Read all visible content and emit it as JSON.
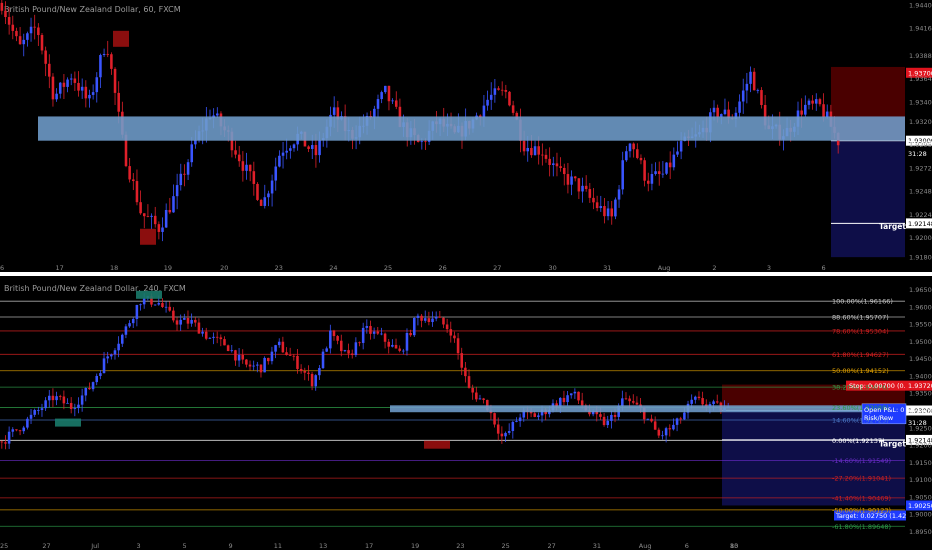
{
  "theme": {
    "bg": "#000000",
    "up": "#3a55ff",
    "down": "#e0202a",
    "zone": "#6f9dcc",
    "fib_grey": "#c8c8c8",
    "fib_red": "#d02020",
    "fib_orange": "#e0a000",
    "fib_green": "#2e9e4a",
    "fib_purple": "#6a2cc7",
    "fib_blue": "#4b79c8",
    "target_box": "#0e0e48",
    "stop_box": "#4a0000",
    "marker_green": "#1a7a6a",
    "marker_red": "#9a1010"
  },
  "chart_data": [
    {
      "type": "candlestick",
      "title": "British Pound/New Zealand Dollar, 60, FXCM",
      "ylim": [
        1.9175,
        1.9445
      ],
      "y_ticks": [
        "1.94400",
        "1.94160",
        "1.93880",
        "1.93640",
        "1.93400",
        "1.93200",
        "1.92960",
        "1.92720",
        "1.92480",
        "1.92240",
        "1.92000",
        "1.91800"
      ],
      "y_tick_values": [
        1.944,
        1.9416,
        1.9388,
        1.9364,
        1.934,
        1.932,
        1.9296,
        1.9272,
        1.9248,
        1.9224,
        1.92,
        1.918
      ],
      "x_ticks": [
        "6",
        "17",
        "18",
        "19",
        "20",
        "23",
        "24",
        "25",
        "26",
        "27",
        "30",
        "31",
        "Aug",
        "2",
        "3",
        "6"
      ],
      "x_tick_fracs": [
        0.0,
        0.066,
        0.131,
        0.195,
        0.262,
        0.327,
        0.392,
        0.457,
        0.522,
        0.587,
        0.653,
        0.718,
        0.783,
        0.848,
        0.913,
        0.978
      ],
      "price_labels": [
        {
          "text": "1.93700",
          "value": 1.937,
          "style": "stop"
        },
        {
          "text": "1.93000",
          "value": 1.93,
          "style": "white"
        },
        {
          "text": "1.92975",
          "value": 1.92975,
          "style": "plain"
        },
        {
          "text": "31:28",
          "value": 1.9287,
          "style": "plain"
        },
        {
          "text": "1.92148",
          "value": 1.92148,
          "style": "white"
        }
      ],
      "annotations": [
        {
          "text": "Target",
          "value": 1.9212
        }
      ],
      "zone": [
        1.93,
        1.9325
      ],
      "series_anchors": [
        1.9442,
        1.9395,
        1.9418,
        1.9345,
        1.9368,
        1.9338,
        1.9405,
        1.929,
        1.9225,
        1.921,
        1.9245,
        1.9295,
        1.933,
        1.9305,
        1.927,
        1.9235,
        1.929,
        1.9305,
        1.9285,
        1.933,
        1.9305,
        1.932,
        1.935,
        1.9315,
        1.9295,
        1.932,
        1.9305,
        1.932,
        1.9345,
        1.935,
        1.9295,
        1.929,
        1.9265,
        1.9255,
        1.9235,
        1.922,
        1.9305,
        1.926,
        1.9265,
        1.9295,
        1.9305,
        1.933,
        1.9325,
        1.937,
        1.931,
        1.9308,
        1.9335,
        1.9335,
        1.93
      ]
    },
    {
      "type": "candlestick",
      "title": "British Pound/New Zealand Dollar, 240, FXCM",
      "ylim": [
        1.8925,
        1.9675
      ],
      "y_ticks": [
        "1.96500",
        "1.96000",
        "1.95500",
        "1.95000",
        "1.94500",
        "1.94000",
        "1.93500",
        "1.92500",
        "1.92000",
        "1.91500",
        "1.91000",
        "1.90500",
        "1.90000",
        "1.89500"
      ],
      "y_tick_values": [
        1.965,
        1.96,
        1.955,
        1.95,
        1.945,
        1.94,
        1.935,
        1.925,
        1.92,
        1.915,
        1.91,
        1.905,
        1.9,
        1.895
      ],
      "x_ticks": [
        "25",
        "27",
        "Jul",
        "3",
        "5",
        "9",
        "11",
        "13",
        "17",
        "19",
        "23",
        "25",
        "27",
        "31",
        "Aug",
        "6",
        "8",
        "10",
        "13"
      ],
      "x_tick_fracs": [
        0.0,
        0.058,
        0.125,
        0.187,
        0.25,
        0.313,
        0.375,
        0.437,
        0.5,
        0.563,
        0.625,
        0.687,
        0.75,
        0.812,
        0.875,
        0.938,
        1.0,
        1.0,
        1.0
      ],
      "fib_levels": [
        {
          "label": "100.00%(1.96166)",
          "value": 1.96166,
          "color": "grey"
        },
        {
          "label": "88.60%(1.95707)",
          "value": 1.95707,
          "color": "grey"
        },
        {
          "label": "78.60%(1.95304)",
          "value": 1.95304,
          "color": "red"
        },
        {
          "label": "61.80%(1.94627)",
          "value": 1.94627,
          "color": "red"
        },
        {
          "label": "50.00%(1.94152)",
          "value": 1.94152,
          "color": "orange"
        },
        {
          "label": "38.20%(1.93676)",
          "value": 1.93676,
          "color": "green"
        },
        {
          "label": "23.60%(1.93088)",
          "value": 1.93088,
          "color": "green"
        },
        {
          "label": "14.60%(1.92725)",
          "value": 1.92725,
          "color": "blue"
        },
        {
          "label": "0.00%(1.92137)",
          "value": 1.92137,
          "color": "white"
        },
        {
          "label": "-14.60%(1.91549)",
          "value": 1.91549,
          "color": "purple"
        },
        {
          "label": "-27.20%(1.91041)",
          "value": 1.91041,
          "color": "red"
        },
        {
          "label": "-41.40%(1.90469)",
          "value": 1.90469,
          "color": "red"
        },
        {
          "label": "-50.00%(1.90123)",
          "value": 1.90123,
          "color": "orange"
        },
        {
          "label": "-61.80%(1.89648)",
          "value": 1.89648,
          "color": "green"
        }
      ],
      "price_labels": [
        {
          "text": "1.93720",
          "value": 1.9372,
          "style": "stop"
        },
        {
          "text": "1.93000",
          "value": 1.93,
          "style": "white"
        },
        {
          "text": "1.92975",
          "value": 1.92975,
          "style": "plain"
        },
        {
          "text": "31:28",
          "value": 1.9265,
          "style": "plain"
        },
        {
          "text": "1.92148",
          "value": 1.92148,
          "style": "white"
        },
        {
          "text": "1.90250",
          "value": 1.9025,
          "style": "blue"
        }
      ],
      "position_labels": {
        "stop": "Stop: 0.00700 (0.",
        "open_pl": "Open P&L: 0",
        "risk": "Risk/Rew",
        "target": "Target: 0.02750 (1.42"
      },
      "annotations": [
        {
          "text": "Target",
          "value": 1.9205
        }
      ],
      "zone": [
        1.9295,
        1.9315
      ],
      "series_anchors": [
        1.921,
        1.925,
        1.9295,
        1.934,
        1.931,
        1.936,
        1.945,
        1.952,
        1.962,
        1.9615,
        1.956,
        1.9555,
        1.951,
        1.949,
        1.943,
        1.9425,
        1.949,
        1.944,
        1.938,
        1.952,
        1.945,
        1.9535,
        1.951,
        1.9465,
        1.957,
        1.957,
        1.953,
        1.936,
        1.932,
        1.9215,
        1.929,
        1.9285,
        1.932,
        1.935,
        1.929,
        1.926,
        1.9335,
        1.93,
        1.9225,
        1.926,
        1.933,
        1.9315,
        1.93
      ]
    }
  ]
}
